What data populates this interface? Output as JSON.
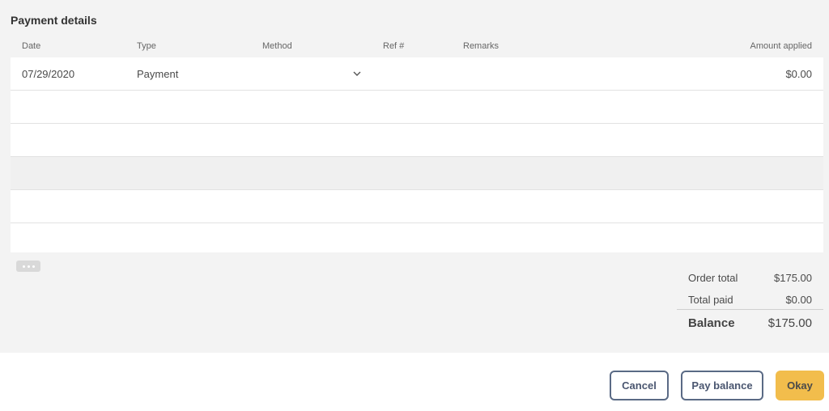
{
  "title": "Payment details",
  "columns": {
    "date": "Date",
    "type": "Type",
    "method": "Method",
    "ref": "Ref #",
    "remarks": "Remarks",
    "amount": "Amount applied"
  },
  "rows": [
    {
      "date": "07/29/2020",
      "type": "Payment",
      "method": "",
      "ref": "",
      "remarks": "",
      "amount": "$0.00"
    }
  ],
  "summary": {
    "order_total_label": "Order total",
    "order_total_value": "$175.00",
    "total_paid_label": "Total paid",
    "total_paid_value": "$0.00",
    "balance_label": "Balance",
    "balance_value": "$175.00"
  },
  "buttons": {
    "cancel": "Cancel",
    "pay_balance": "Pay balance",
    "okay": "Okay"
  },
  "icons": {
    "method_dropdown": "chevron-down-icon",
    "more": "more-horizontal-icon"
  },
  "colors": {
    "accent": "#f2bd4c",
    "button_border": "#5a6a85",
    "panel_bg": "#f3f3f3"
  }
}
